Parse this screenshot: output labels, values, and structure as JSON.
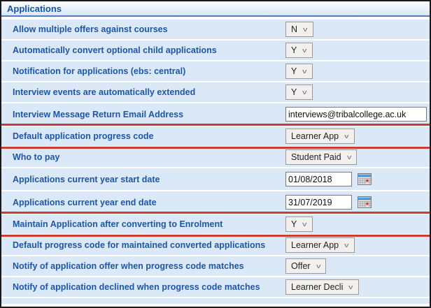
{
  "panel": {
    "title": "Applications"
  },
  "settings": [
    {
      "label": "Allow multiple offers against courses",
      "control": "select",
      "value": "N",
      "highlighted": false
    },
    {
      "label": "Automatically convert optional child applications",
      "control": "select",
      "value": "Y",
      "highlighted": false
    },
    {
      "label": "Notification for applications (ebs: central)",
      "control": "select",
      "value": "Y",
      "highlighted": false
    },
    {
      "label": "Interview events are automatically extended",
      "control": "select",
      "value": "Y",
      "highlighted": false
    },
    {
      "label": "Interview Message Return Email Address",
      "control": "text",
      "value": "interviews@tribalcollege.ac.uk",
      "highlighted": false
    },
    {
      "label": "Default application progress code",
      "control": "select",
      "value": "Learner App",
      "highlighted": true
    },
    {
      "label": "Who to pay",
      "control": "select",
      "value": "Student Paid",
      "highlighted": false
    },
    {
      "label": "Applications current year start date",
      "control": "date",
      "value": "01/08/2018",
      "highlighted": false
    },
    {
      "label": "Applications current year end date",
      "control": "date",
      "value": "31/07/2019",
      "highlighted": false
    },
    {
      "label": "Maintain Application after converting to Enrolment",
      "control": "select",
      "value": "Y",
      "highlighted": true
    },
    {
      "label": "Default progress code for maintained converted applications",
      "control": "select",
      "value": "Learner App",
      "highlighted": false
    },
    {
      "label": "Notify of application offer when progress code matches",
      "control": "select",
      "value": "Offer",
      "highlighted": false
    },
    {
      "label": "Notify of application declined when progress code matches",
      "control": "select",
      "value": "Learner Decli",
      "highlighted": false
    }
  ],
  "icons": {
    "chevron": "chevron-down-icon",
    "calendar": "calendar-icon"
  },
  "colors": {
    "highlight_red": "#ce3a34",
    "row_background": "#dbe8f8",
    "label_blue": "#1d57a8",
    "header_blue": "#1553a5",
    "header_rule": "#4a7fc1"
  }
}
